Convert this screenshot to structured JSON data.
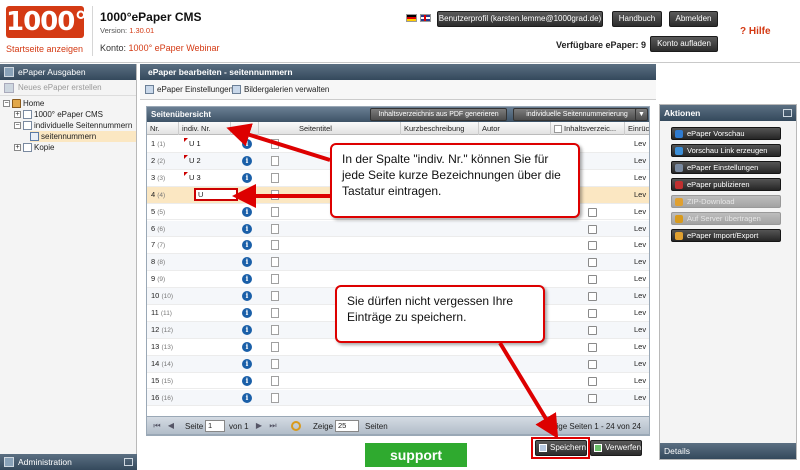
{
  "header": {
    "logo_text": "1000°",
    "logo_link": "Startseite anzeigen",
    "app_title": "1000°ePaper CMS",
    "version_label": "Version:",
    "version_value": "1.30.01",
    "konto_label": "Konto:",
    "konto_value": "1000° ePaper Webinar",
    "profile_button": "Benutzerprofil (karsten.lemme@1000grad.de)",
    "handbuch_button": "Handbuch",
    "abmelden_button": "Abmelden",
    "hilfe": "? Hilfe",
    "available_label": "Verfügbare ePaper: 9",
    "konto_button": "Konto aufladen"
  },
  "left": {
    "panel_title": "ePaper Ausgaben",
    "new_epaper": "Neues ePaper erstellen",
    "tree": [
      {
        "label": "Home",
        "indent": 0
      },
      {
        "label": "1000° ePaper CMS",
        "indent": 1
      },
      {
        "label": "individuelle Seitennummern",
        "indent": 1
      },
      {
        "label": "seitennummern",
        "indent": 2
      },
      {
        "label": "Kopie",
        "indent": 1
      }
    ],
    "admin": "Administration"
  },
  "center": {
    "panel_title": "ePaper bearbeiten - seitennummern",
    "tool_settings": "ePaper Einstellungen",
    "tool_gallery": "Bildergalerien verwalten",
    "grid_title": "Seitenübersicht",
    "btn_pdf": "Inhaltsverzeichnis aus PDF generieren",
    "btn_indiv": "individuelle Seitennummerierung",
    "columns": [
      "Nr.",
      "indiv. Nr.",
      "Seitentitel",
      "Kurzbeschreibung",
      "Autor",
      "Inhaltsverzeic...",
      "Einrüc"
    ],
    "rows": [
      {
        "nr": "1",
        "sub": "(1)",
        "indiv": "U 1",
        "lev": "Lev"
      },
      {
        "nr": "2",
        "sub": "(2)",
        "indiv": "U 2",
        "lev": "Lev"
      },
      {
        "nr": "3",
        "sub": "(3)",
        "indiv": "U 3",
        "lev": "Lev"
      },
      {
        "nr": "4",
        "sub": "(4)",
        "indiv": "U",
        "lev": "Lev"
      },
      {
        "nr": "5",
        "sub": "(5)",
        "indiv": "",
        "lev": "Lev"
      },
      {
        "nr": "6",
        "sub": "(6)",
        "indiv": "",
        "lev": "Lev"
      },
      {
        "nr": "7",
        "sub": "(7)",
        "indiv": "",
        "lev": "Lev"
      },
      {
        "nr": "8",
        "sub": "(8)",
        "indiv": "",
        "lev": "Lev"
      },
      {
        "nr": "9",
        "sub": "(9)",
        "indiv": "",
        "lev": "Lev"
      },
      {
        "nr": "10",
        "sub": "(10)",
        "indiv": "",
        "lev": "Lev"
      },
      {
        "nr": "11",
        "sub": "(11)",
        "indiv": "",
        "lev": "Lev"
      },
      {
        "nr": "12",
        "sub": "(12)",
        "indiv": "",
        "lev": "Lev"
      },
      {
        "nr": "13",
        "sub": "(13)",
        "indiv": "",
        "lev": "Lev"
      },
      {
        "nr": "14",
        "sub": "(14)",
        "indiv": "",
        "lev": "Lev"
      },
      {
        "nr": "15",
        "sub": "(15)",
        "indiv": "",
        "lev": "Lev"
      },
      {
        "nr": "16",
        "sub": "(16)",
        "indiv": "",
        "lev": "Lev"
      }
    ],
    "pager": {
      "seite": "Seite",
      "page_value": "1",
      "von": "von 1",
      "zeige": "Zeige",
      "per_page": "25",
      "seiten": "Seiten",
      "info": "Zeige Seiten 1 - 24 von 24"
    },
    "save_button": "Speichern",
    "discard_button": "Verwerfen",
    "support": "support"
  },
  "right": {
    "panel_title": "Aktionen",
    "actions": [
      {
        "label": "ePaper Vorschau",
        "disabled": false
      },
      {
        "label": "Vorschau Link erzeugen",
        "disabled": false
      },
      {
        "label": "ePaper Einstellungen",
        "disabled": false
      },
      {
        "label": "ePaper publizieren",
        "disabled": false
      },
      {
        "label": "ZIP-Download",
        "disabled": true
      },
      {
        "label": "Auf Server übertragen",
        "disabled": true
      },
      {
        "label": "ePaper Import/Export",
        "disabled": false
      }
    ],
    "details": "Details"
  },
  "callouts": {
    "first": "In der Spalte \"indiv. Nr.\" können Sie für jede Seite kurze Bezeichnungen über die Tastatur eintragen.",
    "second": "Sie dürfen nicht vergessen Ihre Einträge zu speichern."
  },
  "colors": {
    "accent_red": "#d43a14",
    "header_blue": "#34495c",
    "highlight_row": "#fbe7c2",
    "support_green": "#2faa2f",
    "callout_border": "#dd0000"
  }
}
